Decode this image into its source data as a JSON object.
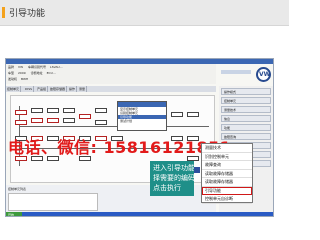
{
  "page": {
    "header_title": "引导功能"
  },
  "app": {
    "info_rows": [
      [
        "品牌",
        "VW",
        "车辆识别代号",
        "LSVAU..."
      ],
      [
        "车型",
        "2009",
        "诊断地址",
        "ECU..."
      ],
      [
        "发动机",
        "BWH",
        "",
        ""
      ]
    ],
    "tabs": [
      "控制单元",
      "DISS",
      "产品组",
      "故障存储器",
      "操作",
      "测量"
    ],
    "context_menu": {
      "items": [
        "显示控制单元",
        "识别控制单元",
        "引导功能",
        "测试计划"
      ],
      "selected_index": 2
    },
    "right_panel": {
      "buttons": [
        "操作模式",
        "控制单元",
        "测量技术",
        "信息",
        "功能",
        "故障查询",
        "引导功能",
        "附加功能",
        "打印"
      ],
      "highlighted_index": 6
    },
    "bottom": {
      "label": "控制单元列表"
    },
    "taskbar": {
      "start": "开始"
    }
  },
  "popup_menu": {
    "items": [
      "测量技术",
      "识别控制单元",
      "故障查询",
      "读取故障存储器",
      "读取故障存储器",
      "引导功能",
      "控制单元自诊断",
      "打印所有"
    ],
    "highlighted_index": 5
  },
  "callout": {
    "lines": [
      "进入引导功能，选",
      "择需要的编码，",
      "点击执行"
    ]
  },
  "watermark": {
    "text": "电话、微信: 15816121851"
  },
  "colors": {
    "accent": "#3b67b3",
    "highlight": "#d01818",
    "callout_bg": "#1f8f89",
    "watermark": "#e21a1a"
  }
}
